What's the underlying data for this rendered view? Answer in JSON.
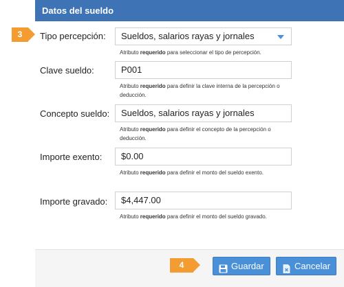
{
  "section": {
    "title": "Datos del sueldo"
  },
  "steps": {
    "step3": "3",
    "step4": "4"
  },
  "fields": {
    "tipo_percepcion": {
      "label": "Tipo percepción:",
      "value": "Sueldos, salarios  rayas y jornales",
      "help_prefix": "Atributo ",
      "help_strong": "requerido",
      "help_suffix": " para seleccionar el tipo de percepción."
    },
    "clave_sueldo": {
      "label": "Clave sueldo:",
      "value": "P001",
      "help_prefix": "Atributo ",
      "help_strong": "requerido",
      "help_suffix": " para definir la clave interna de la percepción o deducción."
    },
    "concepto_sueldo": {
      "label": "Concepto sueldo:",
      "value": "Sueldos, salarios  rayas y jornales",
      "help_prefix": "Atributo ",
      "help_strong": "requerido",
      "help_suffix": " para definir el concepto de la percepción o deducción."
    },
    "importe_exento": {
      "label": "Importe exento:",
      "value": "$0.00",
      "help_prefix": "Atributo ",
      "help_strong": "requerido",
      "help_suffix": " para definir el monto del sueldo exento."
    },
    "importe_gravado": {
      "label": "Importe gravado:",
      "value": "$4,447.00",
      "help_prefix": "Atributo ",
      "help_strong": "requerido",
      "help_suffix": " para definir el monto del sueldo gravado."
    }
  },
  "buttons": {
    "save": "Guardar",
    "cancel": "Cancelar"
  },
  "icons": {
    "save": "floppy-disk-icon",
    "cancel": "document-cancel-icon",
    "dropdown": "chevron-down-icon"
  },
  "colors": {
    "header": "#3e74b6",
    "step_badge": "#f39c32",
    "button": "#4a90d9"
  }
}
